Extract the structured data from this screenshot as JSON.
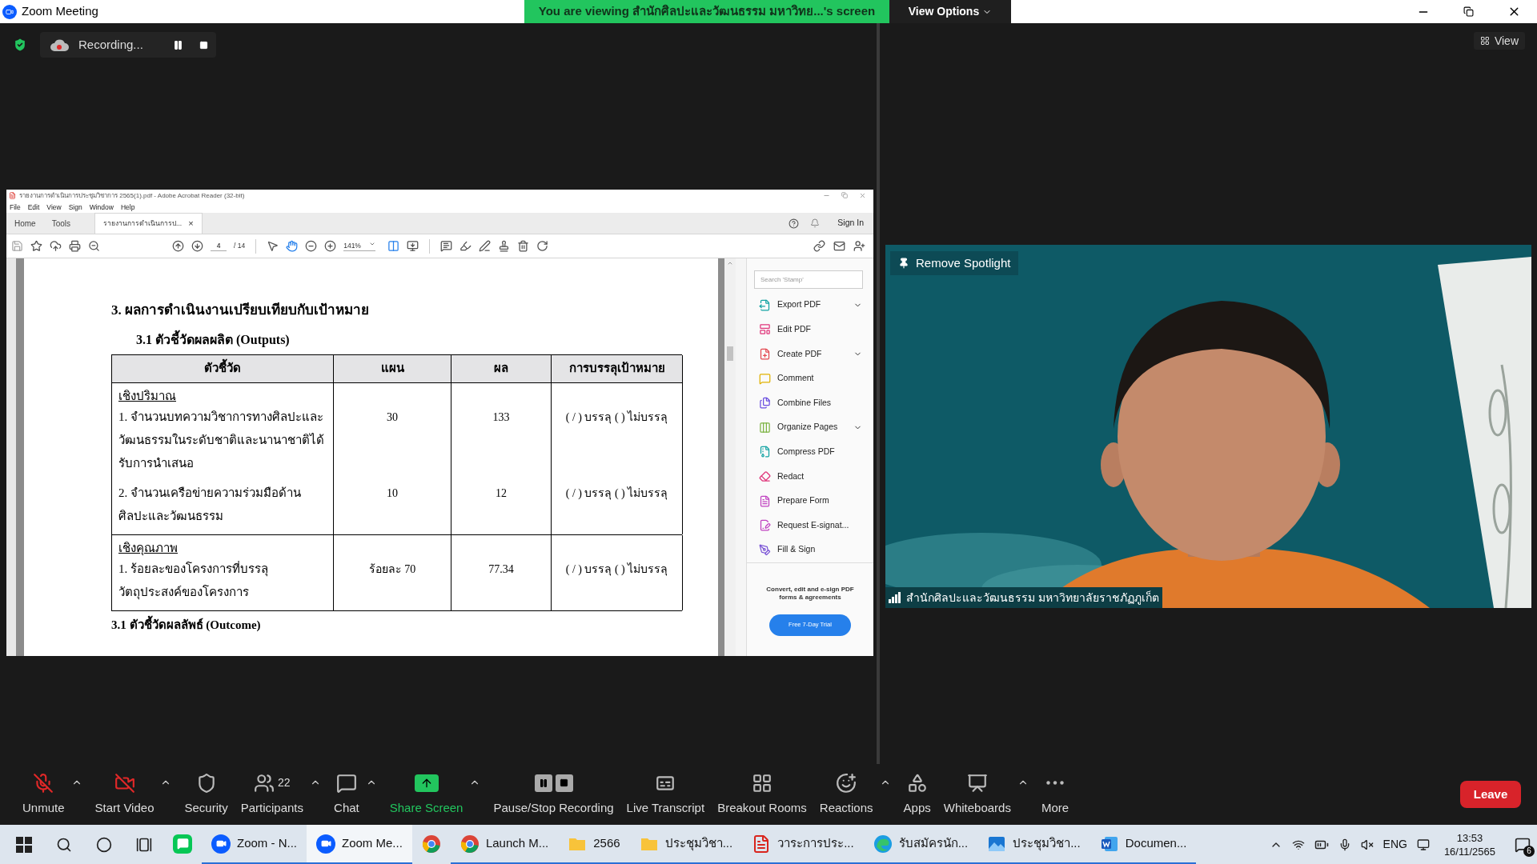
{
  "window": {
    "title": "Zoom Meeting"
  },
  "share_banner": {
    "text": "You are viewing สำนักศิลปะและวัฒนธรรม มหาวิทย...'s screen",
    "button": "View Options"
  },
  "recording": {
    "label": "Recording..."
  },
  "view_button": "View",
  "shared_window": {
    "title": "รายงานการดำเนินการประชุมวิชาการ 2565(1).pdf - Adobe Acrobat Reader (32-bit)",
    "menu": [
      "File",
      "Edit",
      "View",
      "Sign",
      "Window",
      "Help"
    ],
    "tabs": [
      {
        "label": "Home",
        "selected": false,
        "closable": false
      },
      {
        "label": "Tools",
        "selected": false,
        "closable": false
      },
      {
        "label": "รายงานการดำเนินการป...",
        "selected": true,
        "closable": true
      }
    ],
    "close_glyph": "×",
    "sign_in": "Sign In",
    "page_number": "4",
    "page_total": "/ 14",
    "zoom": "141%",
    "document": {
      "heading": "3.  ผลการดำเนินงานเปรียบเทียบกับเป้าหมาย",
      "subheading": "3.1 ตัวชี้วัดผลผลิต (Outputs)",
      "table": {
        "columns": [
          "ตัวชี้วัด",
          "แผน",
          "ผล",
          "การบรรลุเป้าหมาย"
        ],
        "sections": [
          {
            "title": "เชิงปริมาณ",
            "rows": [
              {
                "indicator": "1. จำนวนบทความวิชาการทางศิลปะและวัฒนธรรมในระดับชาติและนานาชาติได้รับการนำเสนอ",
                "plan": "30",
                "result": "133",
                "status": "( / ) บรรลุ ( ) ไม่บรรลุ"
              },
              {
                "indicator": "2. จำนวนเครือข่ายความร่วมมือด้านศิลปะและวัฒนธรรม",
                "plan": "10",
                "result": "12",
                "status": "( / ) บรรลุ ( ) ไม่บรรลุ"
              }
            ]
          },
          {
            "title": "เชิงคุณภาพ",
            "rows": [
              {
                "indicator": "1. ร้อยละของโครงการที่บรรลุวัตถุประสงค์ของโครงการ",
                "plan": "ร้อยละ 70",
                "result": "77.34",
                "status": "( / ) บรรลุ ( ) ไม่บรรลุ"
              }
            ]
          }
        ]
      },
      "next_heading": "3.1 ตัวชี้วัดผลลัพธ์ (Outcome)"
    },
    "tools_panel": {
      "search_placeholder": "Search 'Stamp'",
      "items": [
        {
          "kind": "export",
          "label": "Export PDF",
          "expandable": true
        },
        {
          "kind": "edit",
          "label": "Edit PDF",
          "expandable": false
        },
        {
          "kind": "create",
          "label": "Create PDF",
          "expandable": true
        },
        {
          "kind": "comment",
          "label": "Comment",
          "expandable": false
        },
        {
          "kind": "combine",
          "label": "Combine Files",
          "expandable": false
        },
        {
          "kind": "organize",
          "label": "Organize Pages",
          "expandable": true
        },
        {
          "kind": "compress",
          "label": "Compress PDF",
          "expandable": false
        },
        {
          "kind": "redact",
          "label": "Redact",
          "expandable": false
        },
        {
          "kind": "form",
          "label": "Prepare Form",
          "expandable": false
        },
        {
          "kind": "esign",
          "label": "Request E-signat...",
          "expandable": false
        },
        {
          "kind": "sign",
          "label": "Fill & Sign",
          "expandable": false
        }
      ],
      "promo": "Convert, edit and e-sign PDF forms & agreements",
      "trial_button": "Free 7-Day Trial"
    }
  },
  "video": {
    "overlay_button": "Remove Spotlight",
    "participant_name": "สำนักศิลปะและวัฒนธรรม มหาวิทยาลัยราชภัฏภูเก็ต"
  },
  "toolbar": [
    {
      "kind": "audio",
      "label": "Unmute",
      "off": true,
      "menu": true
    },
    {
      "kind": "video",
      "label": "Start Video",
      "off": true,
      "menu": true
    },
    {
      "kind": "security",
      "label": "Security",
      "off": false,
      "menu": false
    },
    {
      "kind": "participants",
      "label": "Participants",
      "count": "22",
      "off": false,
      "menu": true
    },
    {
      "kind": "chat",
      "label": "Chat",
      "off": false,
      "menu": true
    },
    {
      "kind": "share",
      "label": "Share Screen",
      "off": false,
      "menu": true
    },
    {
      "kind": "recording",
      "label": "Pause/Stop Recording",
      "off": false,
      "menu": false
    },
    {
      "kind": "transcript",
      "label": "Live Transcript",
      "off": false,
      "menu": false
    },
    {
      "kind": "breakout",
      "label": "Breakout Rooms",
      "off": false,
      "menu": false
    },
    {
      "kind": "reactions",
      "label": "Reactions",
      "off": false,
      "menu": true
    },
    {
      "kind": "apps",
      "label": "Apps",
      "off": false,
      "menu": false
    },
    {
      "kind": "whiteboards",
      "label": "Whiteboards",
      "off": false,
      "menu": true
    },
    {
      "kind": "more",
      "label": "More",
      "off": false,
      "menu": false
    }
  ],
  "leave_button": "Leave",
  "taskbar": {
    "apps": [
      {
        "kind": "line",
        "open": false,
        "selected": false
      },
      {
        "kind": "zoom",
        "label": "Zoom - N...",
        "open": true,
        "selected": false
      },
      {
        "kind": "zoom",
        "label": "Zoom Me...",
        "open": true,
        "selected": true
      },
      {
        "kind": "chrome",
        "open": false,
        "selected": false
      },
      {
        "kind": "chrome",
        "label": "Launch M...",
        "open": true,
        "selected": false
      },
      {
        "kind": "folder",
        "label": "2566",
        "open": true,
        "selected": false
      },
      {
        "kind": "folder",
        "label": "ประชุมวิชา...",
        "open": true,
        "selected": false
      },
      {
        "kind": "pdf",
        "label": "วาระการประ...",
        "open": true,
        "selected": false
      },
      {
        "kind": "edge",
        "label": "รับสมัครนัก...",
        "open": true,
        "selected": false
      },
      {
        "kind": "photos",
        "label": "ประชุมวิชา...",
        "open": true,
        "selected": false
      },
      {
        "kind": "word",
        "label": "Documen...",
        "open": true,
        "selected": false
      }
    ],
    "language": "ENG",
    "time": "13:53",
    "date": "16/11/2565",
    "notifications": "6"
  }
}
